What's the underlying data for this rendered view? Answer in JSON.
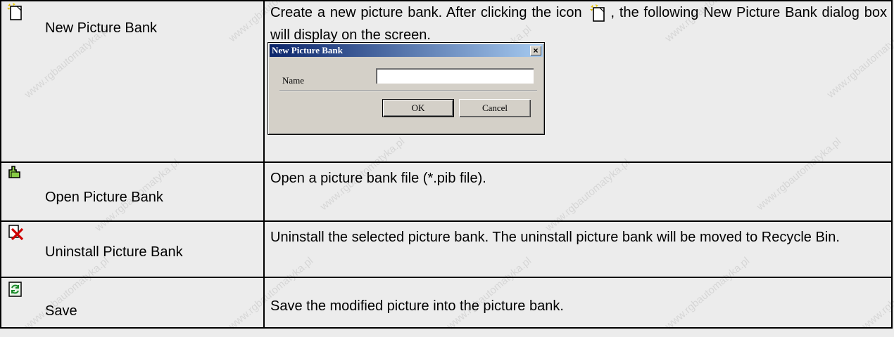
{
  "rows": [
    {
      "icon": "new-picture-bank-icon",
      "label": "New Picture Bank",
      "desc_before": "Create a new picture bank. After clicking the icon",
      "desc_after": ", the following New Picture Bank dialog box will display on the screen.",
      "dialog": {
        "title": "New Picture Bank",
        "close_glyph": "×",
        "name_label": "Name",
        "name_value": "",
        "ok_label": "OK",
        "cancel_label": "Cancel"
      }
    },
    {
      "icon": "open-picture-bank-icon",
      "label": "Open Picture Bank",
      "desc": "Open a picture bank file (*.pib file)."
    },
    {
      "icon": "uninstall-picture-bank-icon",
      "label": "Uninstall Picture Bank",
      "desc": "Uninstall the selected picture bank. The uninstall picture bank will be moved to Recycle Bin."
    },
    {
      "icon": "save-icon",
      "label": "Save",
      "desc": "Save the modified picture into the picture bank."
    }
  ],
  "watermark": "www.rgbautomatyka.pl",
  "colors": {
    "background": "#ececec",
    "border": "#000000",
    "dialog_face": "#d4d0c8",
    "titlebar_start": "#0a246a",
    "titlebar_end": "#a6caf0"
  }
}
